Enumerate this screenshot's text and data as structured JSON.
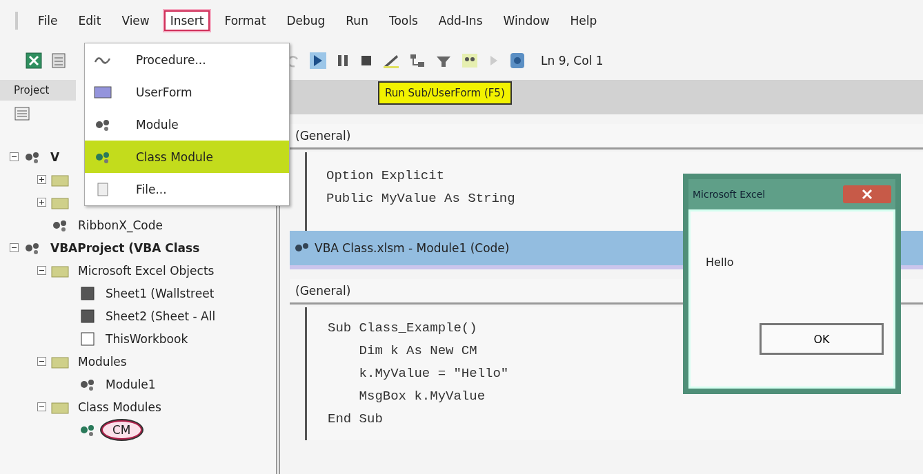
{
  "menu_bar": [
    {
      "label": "File",
      "selected": false
    },
    {
      "label": "Edit",
      "selected": false
    },
    {
      "label": "View",
      "selected": false
    },
    {
      "label": "Insert",
      "selected": true
    },
    {
      "label": "Format",
      "selected": false
    },
    {
      "label": "Debug",
      "selected": false
    },
    {
      "label": "Run",
      "selected": false
    },
    {
      "label": "Tools",
      "selected": false
    },
    {
      "label": "Add-Ins",
      "selected": false
    },
    {
      "label": "Window",
      "selected": false
    },
    {
      "label": "Help",
      "selected": false
    }
  ],
  "toolbar": {
    "position": "Ln 9, Col 1"
  },
  "insert_menu": [
    {
      "label": "Procedure...",
      "kind": "procedure",
      "selected": false
    },
    {
      "label": "UserForm",
      "kind": "userform",
      "selected": false
    },
    {
      "label": "Module",
      "kind": "module",
      "selected": false
    },
    {
      "label": "Class Module",
      "kind": "class",
      "selected": true
    },
    {
      "label": "File...",
      "kind": "file",
      "selected": false
    }
  ],
  "tooltip": "Run Sub/UserForm (F5)",
  "project_panel": {
    "title": "Project",
    "tree": [
      {
        "label": "V",
        "kind": "project",
        "expanded": true,
        "selected": false,
        "children": [
          {
            "kind": "folder",
            "expanded": false
          },
          {
            "kind": "folder",
            "expanded": false
          },
          {
            "label": "RibbonX_Code",
            "kind": "module",
            "selected": false
          }
        ]
      },
      {
        "label": "VBAProject (VBA Class",
        "kind": "project",
        "expanded": true,
        "selected": false,
        "children": [
          {
            "label": "Microsoft Excel Objects",
            "kind": "folder",
            "expanded": true,
            "selected": false,
            "children": [
              {
                "label": "Sheet1 (Wallstreet",
                "kind": "sheet",
                "selected": false
              },
              {
                "label": "Sheet2 (Sheet - All",
                "kind": "sheet",
                "selected": false
              },
              {
                "label": "ThisWorkbook",
                "kind": "workbook",
                "selected": false
              }
            ]
          },
          {
            "label": "Modules",
            "kind": "folder",
            "expanded": true,
            "selected": false,
            "children": [
              {
                "label": "Module1",
                "kind": "module",
                "selected": false
              }
            ]
          },
          {
            "label": "Class Modules",
            "kind": "folder",
            "expanded": true,
            "selected": false,
            "children": [
              {
                "label": "CM",
                "kind": "class",
                "selected": true
              }
            ]
          }
        ]
      }
    ]
  },
  "code_windows": [
    {
      "active": false,
      "object": "(General)",
      "lines": [
        "Option Explicit",
        "Public MyValue As String"
      ]
    },
    {
      "title": "VBA Class.xlsm - Module1 (Code)",
      "active": true,
      "object": "(General)",
      "lines": [
        "Sub Class_Example()",
        "    Dim k As New CM",
        "    k.MyValue = \"Hello\"",
        "    MsgBox k.MyValue",
        "End Sub"
      ]
    }
  ],
  "message_box": {
    "title": "Microsoft Excel",
    "message": "Hello",
    "button": "OK"
  }
}
